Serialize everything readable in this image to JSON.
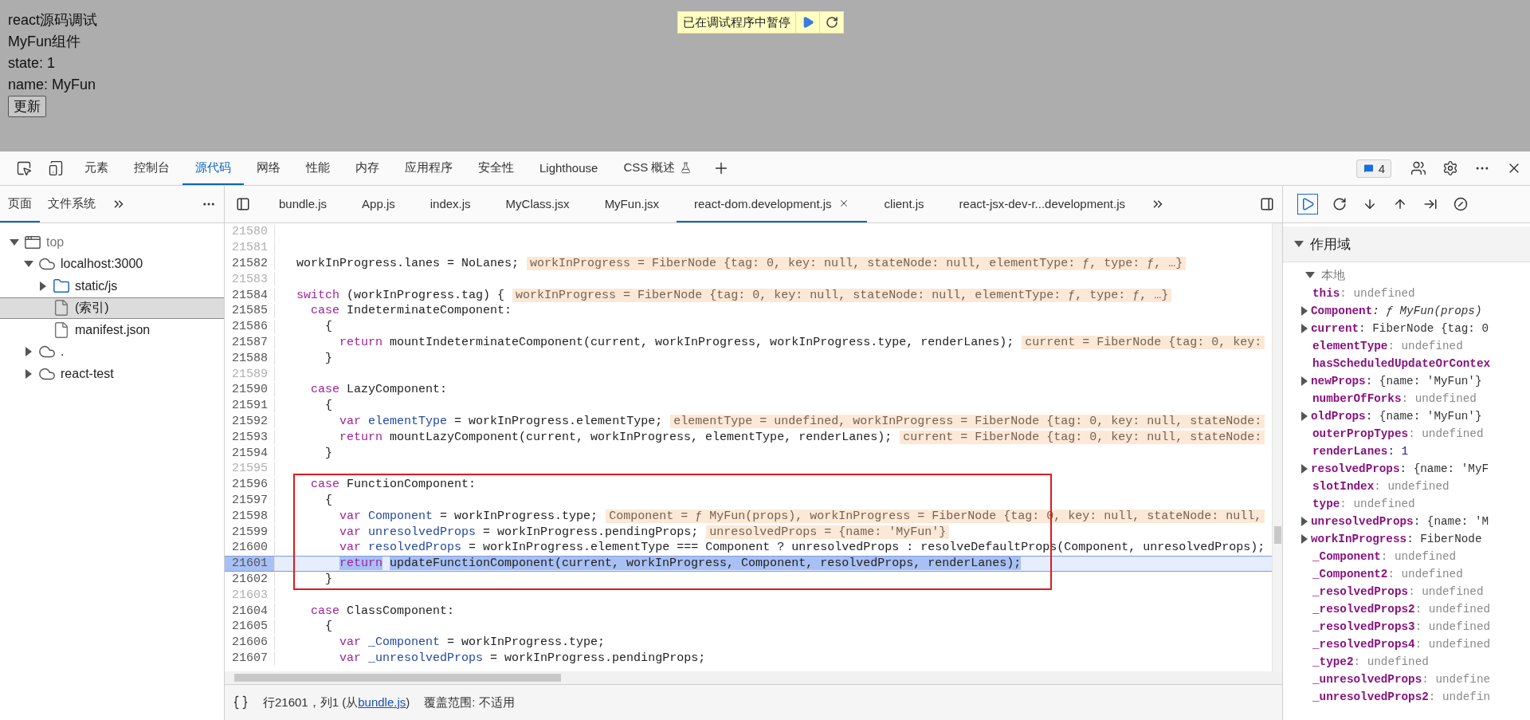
{
  "page": {
    "lines": [
      "react源码调试",
      "MyFun组件",
      "state: 1",
      "name: MyFun"
    ],
    "button": "更新"
  },
  "paused_banner": {
    "text": "已在调试程序中暂停"
  },
  "toolbar": {
    "tabs": [
      {
        "label": "元素",
        "selected": false,
        "beta": false
      },
      {
        "label": "控制台",
        "selected": false,
        "beta": false
      },
      {
        "label": "源代码",
        "selected": true,
        "beta": false
      },
      {
        "label": "网络",
        "selected": false,
        "beta": false
      },
      {
        "label": "性能",
        "selected": false,
        "beta": false
      },
      {
        "label": "内存",
        "selected": false,
        "beta": false
      },
      {
        "label": "应用程序",
        "selected": false,
        "beta": false
      },
      {
        "label": "安全性",
        "selected": false,
        "beta": false
      },
      {
        "label": "Lighthouse",
        "selected": false,
        "beta": false
      },
      {
        "label": "CSS 概述",
        "selected": false,
        "beta": true
      }
    ],
    "issues_count": "4"
  },
  "sidebar": {
    "tabs": [
      {
        "label": "页面",
        "selected": true
      },
      {
        "label": "文件系统",
        "selected": false
      }
    ],
    "tree": [
      {
        "label": "top",
        "kind": "frame",
        "expanded": true,
        "selected": false,
        "children": [
          {
            "label": "localhost:3000",
            "kind": "domain",
            "expanded": true,
            "selected": false,
            "children": [
              {
                "label": "static/js",
                "kind": "folder",
                "expanded": false,
                "selected": false
              },
              {
                "label": "(索引)",
                "kind": "file",
                "selected": true
              },
              {
                "label": "manifest.json",
                "kind": "file",
                "selected": false
              }
            ]
          },
          {
            "label": ".",
            "kind": "domain",
            "expanded": false,
            "selected": false
          },
          {
            "label": "react-test",
            "kind": "domain",
            "expanded": false,
            "selected": false
          }
        ]
      }
    ]
  },
  "file_tabs": [
    {
      "label": "bundle.js",
      "selected": false
    },
    {
      "label": "App.js",
      "selected": false
    },
    {
      "label": "index.js",
      "selected": false
    },
    {
      "label": "MyClass.jsx",
      "selected": false
    },
    {
      "label": "MyFun.jsx",
      "selected": false
    },
    {
      "label": "react-dom.development.js",
      "selected": true
    },
    {
      "label": "client.js",
      "selected": false
    },
    {
      "label": "react-jsx-dev-r...development.js",
      "selected": false
    }
  ],
  "code": {
    "sections": [
      {
        "boxed": false,
        "lines": [
          {
            "number": "21580",
            "muted": true,
            "paused": false
          },
          {
            "number": "21581",
            "muted": true,
            "paused": false
          },
          {
            "number": "21582",
            "muted": false,
            "paused": false,
            "tokens": [
              {
                "kind": "plain",
                "text": "  workInProgress.lanes = NoLanes;"
              }
            ],
            "value": "workInProgress = FiberNode {tag: 0, key: null, stateNode: null, elementType: ƒ, type: ƒ, …}"
          },
          {
            "number": "21583",
            "muted": true,
            "paused": false
          },
          {
            "number": "21584",
            "muted": false,
            "paused": false,
            "tokens": [
              {
                "kind": "keyword",
                "text": "  switch"
              },
              {
                "kind": "plain",
                "text": " (workInProgress.tag) {"
              }
            ],
            "value": "workInProgress = FiberNode {tag: 0, key: null, stateNode: null, elementType: ƒ, type: ƒ, …}"
          },
          {
            "number": "21585",
            "muted": false,
            "paused": false,
            "tokens": [
              {
                "kind": "keyword",
                "text": "    case"
              },
              {
                "kind": "plain",
                "text": " IndeterminateComponent:"
              }
            ]
          },
          {
            "number": "21586",
            "muted": false,
            "paused": false,
            "tokens": [
              {
                "kind": "plain",
                "text": "      {"
              }
            ]
          },
          {
            "number": "21587",
            "muted": false,
            "paused": false,
            "tokens": [
              {
                "kind": "keyword",
                "text": "        return"
              },
              {
                "kind": "plain",
                "text": " mountIndeterminateComponent(current, workInProgress, workInProgress.type, renderLanes);"
              }
            ],
            "value": "current = FiberNode {tag: 0, key:"
          },
          {
            "number": "21588",
            "muted": false,
            "paused": false,
            "tokens": [
              {
                "kind": "plain",
                "text": "      }"
              }
            ]
          },
          {
            "number": "21589",
            "muted": true,
            "paused": false
          },
          {
            "number": "21590",
            "muted": false,
            "paused": false,
            "tokens": [
              {
                "kind": "keyword",
                "text": "    case"
              },
              {
                "kind": "plain",
                "text": " LazyComponent:"
              }
            ]
          },
          {
            "number": "21591",
            "muted": false,
            "paused": false,
            "tokens": [
              {
                "kind": "plain",
                "text": "      {"
              }
            ]
          },
          {
            "number": "21592",
            "muted": false,
            "paused": false,
            "tokens": [
              {
                "kind": "keyword",
                "text": "        var"
              },
              {
                "kind": "def",
                "text": " elementType"
              },
              {
                "kind": "plain",
                "text": " = workInProgress.elementType;"
              }
            ],
            "value": "elementType = undefined, workInProgress = FiberNode {tag: 0, key: null, stateNode:"
          },
          {
            "number": "21593",
            "muted": false,
            "paused": false,
            "tokens": [
              {
                "kind": "keyword",
                "text": "        return"
              },
              {
                "kind": "plain",
                "text": " mountLazyComponent(current, workInProgress, elementType, renderLanes);"
              }
            ],
            "value": "current = FiberNode {tag: 0, key: null, stateNode:"
          },
          {
            "number": "21594",
            "muted": false,
            "paused": false,
            "tokens": [
              {
                "kind": "plain",
                "text": "      }"
              }
            ]
          },
          {
            "number": "21595",
            "muted": true,
            "paused": false
          }
        ]
      },
      {
        "boxed": true,
        "lines": [
          {
            "number": "21596",
            "muted": false,
            "paused": false,
            "tokens": [
              {
                "kind": "keyword",
                "text": "    case"
              },
              {
                "kind": "plain",
                "text": " FunctionComponent:"
              }
            ]
          },
          {
            "number": "21597",
            "muted": false,
            "paused": false,
            "tokens": [
              {
                "kind": "plain",
                "text": "      {"
              }
            ]
          },
          {
            "number": "21598",
            "muted": false,
            "paused": false,
            "tokens": [
              {
                "kind": "keyword",
                "text": "        var"
              },
              {
                "kind": "def",
                "text": " Component"
              },
              {
                "kind": "plain",
                "text": " = workInProgress.type;"
              }
            ],
            "value": "Component = ƒ MyFun(props), workInProgress = FiberNode {tag: 0, key: null, stateNode: null,"
          },
          {
            "number": "21599",
            "muted": false,
            "paused": false,
            "tokens": [
              {
                "kind": "keyword",
                "text": "        var"
              },
              {
                "kind": "def",
                "text": " unresolvedProps"
              },
              {
                "kind": "plain",
                "text": " = workInProgress.pendingProps;"
              }
            ],
            "value": "unresolvedProps = {name: 'MyFun'}"
          },
          {
            "number": "21600",
            "muted": false,
            "paused": false,
            "tokens": [
              {
                "kind": "keyword",
                "text": "        var"
              },
              {
                "kind": "def",
                "text": " resolvedProps"
              },
              {
                "kind": "plain",
                "text": " = workInProgress.elementType === Component ? unresolvedProps : resolveDefaultProps(Component, unresolvedProps);"
              }
            ]
          },
          {
            "number": "21601",
            "muted": false,
            "paused": true,
            "tokens": [
              {
                "kind": "keyword",
                "text": "        return"
              },
              {
                "kind": "plain",
                "text": " updateFunctionComponent(current, workInProgress, Component, resolvedProps, renderLanes);"
              }
            ]
          },
          {
            "number": "21602",
            "muted": false,
            "paused": false,
            "tokens": [
              {
                "kind": "plain",
                "text": "      }"
              }
            ]
          }
        ]
      },
      {
        "boxed": false,
        "lines": [
          {
            "number": "21603",
            "muted": true,
            "paused": false
          },
          {
            "number": "21604",
            "muted": false,
            "paused": false,
            "tokens": [
              {
                "kind": "keyword",
                "text": "    case"
              },
              {
                "kind": "plain",
                "text": " ClassComponent:"
              }
            ]
          },
          {
            "number": "21605",
            "muted": false,
            "paused": false,
            "tokens": [
              {
                "kind": "plain",
                "text": "      {"
              }
            ]
          },
          {
            "number": "21606",
            "muted": false,
            "paused": false,
            "tokens": [
              {
                "kind": "keyword",
                "text": "        var"
              },
              {
                "kind": "def",
                "text": " _Component"
              },
              {
                "kind": "plain",
                "text": " = workInProgress.type;"
              }
            ]
          },
          {
            "number": "21607",
            "muted": false,
            "paused": false,
            "tokens": [
              {
                "kind": "keyword",
                "text": "        var"
              },
              {
                "kind": "def",
                "text": " _unresolvedProps"
              },
              {
                "kind": "plain",
                "text": " = workInProgress.pendingProps;"
              }
            ]
          }
        ]
      }
    ]
  },
  "status": {
    "position": "行21601，列1 (从",
    "source_link": "bundle.js",
    "position_end": ")",
    "coverage": "覆盖范围: 不适用"
  },
  "scope": {
    "title": "作用域",
    "expanded": true,
    "groups": [
      {
        "title": "本地",
        "expanded": true,
        "vars": [
          {
            "text": "**this**: undefined",
            "kind": "undefined",
            "expandable": false
          },
          {
            "text": "**Component**: ƒ MyFun(props)",
            "kind": "function",
            "expandable": true
          },
          {
            "text": "**current**: FiberNode {tag: 0",
            "kind": "object",
            "expandable": true
          },
          {
            "text": "**elementType**: undefined",
            "kind": "undefined",
            "expandable": false
          },
          {
            "text": "**hasScheduledUpdateOrContex**",
            "expandable": false
          },
          {
            "text": "**newProps**: {name: 'MyFun'}",
            "kind": "object",
            "expandable": true
          },
          {
            "text": "**numberOfForks**: undefined",
            "kind": "undefined",
            "expandable": false
          },
          {
            "text": "**oldProps**: {name: 'MyFun'}",
            "kind": "object",
            "expandable": true
          },
          {
            "text": "**outerPropTypes**: undefined",
            "kind": "undefined",
            "expandable": false
          },
          {
            "text": "**renderLanes**: 1",
            "kind": "number",
            "expandable": false
          },
          {
            "text": "**resolvedProps**: {name: 'MyF",
            "kind": "object",
            "expandable": true
          },
          {
            "text": "**slotIndex**: undefined",
            "kind": "undefined",
            "expandable": false
          },
          {
            "text": "**type**: undefined",
            "kind": "undefined",
            "expandable": false
          },
          {
            "text": "**unresolvedProps**: {name: 'M",
            "kind": "object",
            "expandable": true
          },
          {
            "text": "**workInProgress**: FiberNode",
            "kind": "object",
            "expandable": true
          },
          {
            "text": "**_Component**: undefined",
            "kind": "undefined",
            "expandable": false
          },
          {
            "text": "**_Component2**: undefined",
            "kind": "undefined",
            "expandable": false
          },
          {
            "text": "**_resolvedProps**: undefined",
            "kind": "undefined",
            "expandable": false
          },
          {
            "text": "**_resolvedProps2**: undefined",
            "kind": "undefined",
            "expandable": false
          },
          {
            "text": "**_resolvedProps3**: undefined",
            "kind": "undefined",
            "expandable": false
          },
          {
            "text": "**_resolvedProps4**: undefined",
            "kind": "undefined",
            "expandable": false
          },
          {
            "text": "**_type2**: undefined",
            "kind": "undefined",
            "expandable": false
          },
          {
            "text": "**_unresolvedProps**: undefine",
            "kind": "undefined",
            "expandable": false
          },
          {
            "text": "**_unresolvedProps2**: undefin",
            "kind": "undefined",
            "expandable": false
          }
        ]
      }
    ]
  }
}
